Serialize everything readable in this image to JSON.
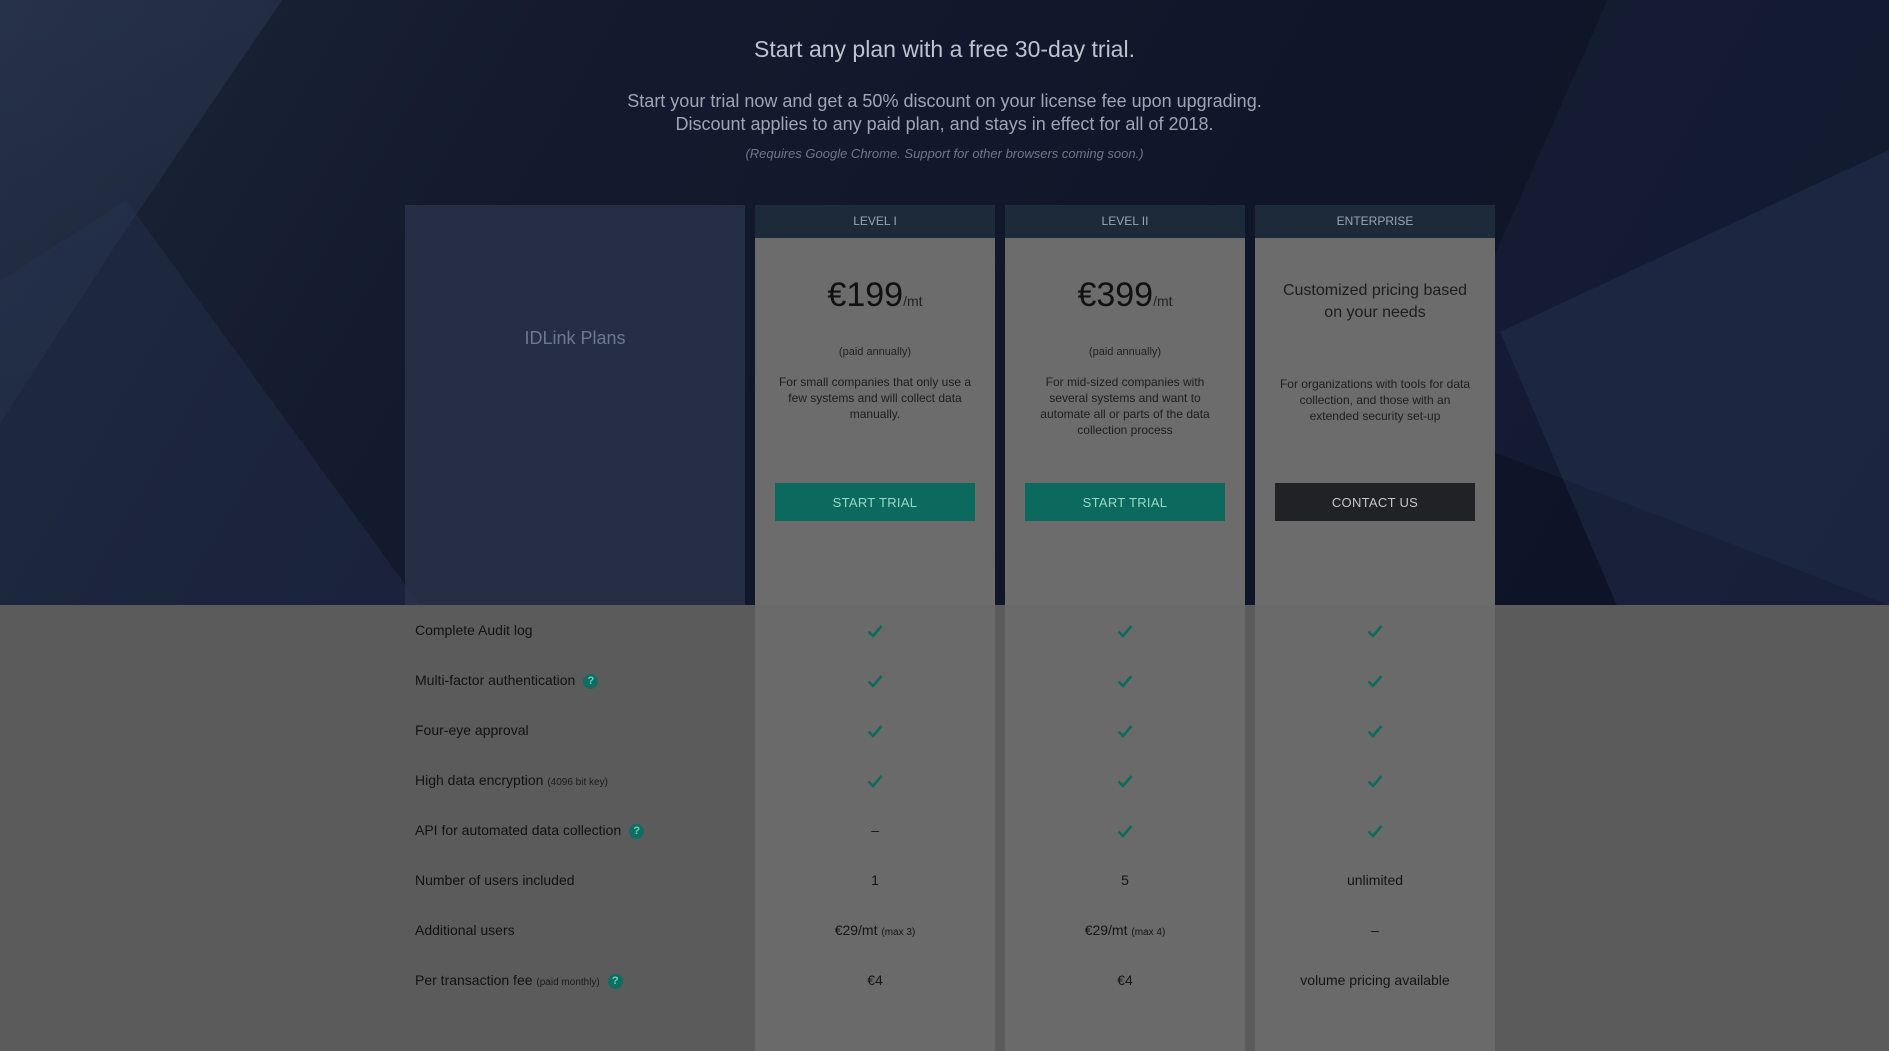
{
  "intro": {
    "title": "Start any plan with a free 30-day trial.",
    "subtitle_line1": "Start your trial now and get a 50% discount on your license fee upon upgrading.",
    "subtitle_line2": "Discount applies to any paid plan, and stays in effect for all of 2018.",
    "note": "(Requires Google Chrome. Support for other browsers coming soon.)"
  },
  "plans_label": "IDLink Plans",
  "plans": [
    {
      "name": "LEVEL I",
      "price": "€199",
      "per": "/mt",
      "billing": "(paid annually)",
      "description": "For small companies that only use a few systems and will collect data manually.",
      "cta": "START TRIAL"
    },
    {
      "name": "LEVEL II",
      "price": "€399",
      "per": "/mt",
      "billing": "(paid annually)",
      "description": "For mid-sized companies with several systems and want to automate all or parts of the data collection process",
      "cta": "START TRIAL"
    },
    {
      "name": "ENTERPRISE",
      "custom": "Customized pricing based on your needs",
      "description": "For organizations with tools for data collection, and those with an extended security set-up",
      "cta": "CONTACT US"
    }
  ],
  "features": [
    {
      "name": "Complete Audit log",
      "values": [
        "check",
        "check",
        "check"
      ]
    },
    {
      "name": "Multi-factor authentication",
      "help": "?",
      "values": [
        "check",
        "check",
        "check"
      ]
    },
    {
      "name": "Four-eye approval",
      "values": [
        "check",
        "check",
        "check"
      ]
    },
    {
      "name": "High data encryption",
      "note": "(4096 bit key)",
      "values": [
        "check",
        "check",
        "check"
      ]
    },
    {
      "name": "API for automated data collection",
      "help": "?",
      "values": [
        "–",
        "check",
        "check"
      ]
    },
    {
      "name": "Number of users included",
      "values": [
        "1",
        "5",
        "unlimited"
      ]
    },
    {
      "name": "Additional users",
      "values": [
        "€29/mt",
        "€29/mt",
        "–"
      ],
      "notes": [
        "(max 3)",
        "(max 4)",
        ""
      ]
    },
    {
      "name": "Per transaction fee",
      "note": "(paid monthly)",
      "help": "?",
      "values": [
        "€4",
        "€4",
        "volume pricing available"
      ]
    }
  ],
  "colors": {
    "accent": "#0b6a5d",
    "check": "#0e6b5c",
    "hero_bg": "#10172a",
    "dark_button": "#202226"
  },
  "icons": {
    "check": "check-icon",
    "help": "help-icon"
  }
}
